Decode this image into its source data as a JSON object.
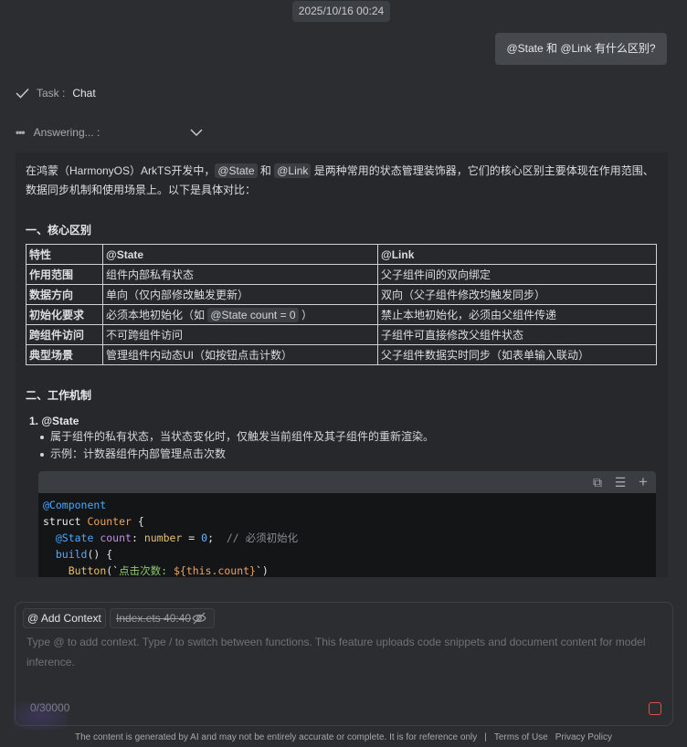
{
  "header": {
    "timestamp": "2025/10/16 00:24"
  },
  "user_message": "@State 和 @Link 有什么区别?",
  "task": {
    "label": "Task :",
    "value": "Chat"
  },
  "answering": {
    "label": "Answering... :"
  },
  "answer": {
    "intro_prefix": "在鸿蒙（HarmonyOS）ArkTS开发中，",
    "intro_code1": "@State",
    "intro_mid": " 和 ",
    "intro_code2": "@Link",
    "intro_suffix": " 是两种常用的状态管理装饰器，它们的核心区别主要体现在作用范围、数据同步机制和使用场景上。以下是具体对比：",
    "section1_title": "一、核心区别",
    "table": {
      "headers": [
        "特性",
        "@State",
        "@Link"
      ],
      "rows": [
        [
          "作用范围",
          "组件内部私有状态",
          "父子组件间的双向绑定"
        ],
        [
          "数据方向",
          "单向（仅内部修改触发更新）",
          "双向（父子组件修改均触发同步）"
        ],
        [
          "初始化要求",
          "必须本地初始化（如",
          "禁止本地初始化，必须由父组件传递"
        ],
        [
          "跨组件访问",
          "不可跨组件访问",
          "子组件可直接修改父组件状态"
        ],
        [
          "典型场景",
          "管理组件内动态UI（如按钮点击计数）",
          "父子组件数据实时同步（如表单输入联动）"
        ]
      ],
      "init_code": "@State count = 0",
      "init_suffix": "）"
    },
    "section2_title": "二、工作机制",
    "item1_title": "1. @State",
    "item1_bullets": [
      "属于组件的私有状态，当状态变化时，仅触发当前组件及其子组件的重新渲染。",
      "示例：计数器组件内部管理点击次数"
    ],
    "code": {
      "line1": "@Component",
      "line2_kw": "struct ",
      "line2_cls": "Counter",
      "line2_rest": " {",
      "line3_ann": "@State ",
      "line3_prop": "count",
      "line3_colon": ": ",
      "line3_type": "number",
      "line3_eq": " = ",
      "line3_num": "0",
      "line3_semi": ";  ",
      "line3_cmt": "// 必须初始化",
      "line4_fn": "build",
      "line4_rest": "() {",
      "line5_fn": "Button",
      "line5_open": "(`",
      "line5_str": "点击次数: ",
      "line5_tpl": "${this.count}",
      "line5_close": "`)"
    }
  },
  "input": {
    "add_context_label": "@ Add Context",
    "file_chip": "Index.ets 40:40",
    "placeholder": "Type @ to add context. Type / to switch between functions. This feature uploads code snippets and document content for model inference.",
    "counter": "0/30000"
  },
  "footer": {
    "disclaimer": "The content is generated by AI and may not be entirely accurate or complete. It is for reference only",
    "separator": "|",
    "terms": "Terms of Use",
    "privacy": "Privacy Policy"
  },
  "colors": {
    "background": "#2b2d30",
    "panel": "#26282b",
    "code_bg": "#131517",
    "stop": "#e0504a"
  }
}
